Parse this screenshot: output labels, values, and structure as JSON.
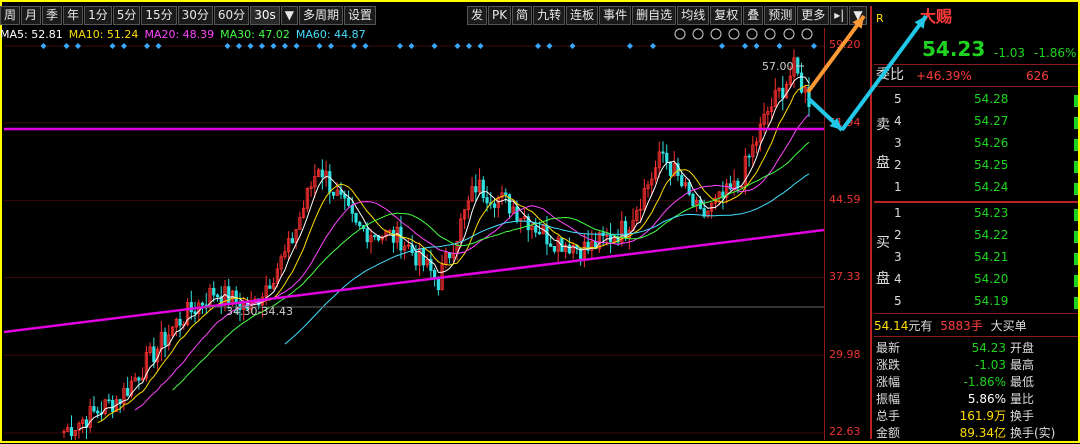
{
  "toolbar": {
    "periods": [
      "周",
      "月",
      "季",
      "年",
      "1分",
      "5分",
      "15分",
      "30分",
      "60分",
      "30s",
      "多周期",
      "设置"
    ],
    "dropdown_glyph": "▼",
    "right_items": [
      "发",
      "PK",
      "简",
      "九转",
      "连板",
      "事件",
      "删自选",
      "均线",
      "复权",
      "叠",
      "预测",
      "更多"
    ]
  },
  "ma_legend": [
    {
      "label": "MA5: 52.81",
      "color": "#ffffff"
    },
    {
      "label": "MA10: 51.24",
      "color": "#ffde00"
    },
    {
      "label": "MA20: 48.39",
      "color": "#ff44ff"
    },
    {
      "label": "MA30: 47.02",
      "color": "#44ff44"
    },
    {
      "label": "MA60: 44.87",
      "color": "#44ddff"
    }
  ],
  "price_axis": [
    "59.20",
    "51.94",
    "44.59",
    "37.33",
    "29.98",
    "22.63"
  ],
  "annotations": {
    "high_label": "57.00",
    "range_label": "34.30-34.43"
  },
  "panel": {
    "r_mark": "R",
    "stock_name": "大赐",
    "price": "54.23",
    "change": "-1.03",
    "change_pct": "-1.86%",
    "weibi_label": "委比",
    "weibi_value": "+46.39%",
    "weicha_value": "626",
    "sell_label": [
      "卖",
      "盘"
    ],
    "buy_label": [
      "买",
      "盘"
    ],
    "sell": [
      {
        "level": "5",
        "price": "54.28"
      },
      {
        "level": "4",
        "price": "54.27"
      },
      {
        "level": "3",
        "price": "54.26"
      },
      {
        "level": "2",
        "price": "54.25"
      },
      {
        "level": "1",
        "price": "54.24"
      }
    ],
    "buy": [
      {
        "level": "1",
        "price": "54.23"
      },
      {
        "level": "2",
        "price": "54.22"
      },
      {
        "level": "3",
        "price": "54.21"
      },
      {
        "level": "4",
        "price": "54.20"
      },
      {
        "level": "5",
        "price": "54.19"
      }
    ],
    "bigbuy": {
      "price": "54.14",
      "unit1": "元有",
      "qty": "5883手",
      "text": "大买单"
    },
    "stats": [
      {
        "l": "最新",
        "v": "54.23",
        "r": "开盘",
        "c": "green"
      },
      {
        "l": "涨跌",
        "v": "-1.03",
        "r": "最高",
        "c": "green"
      },
      {
        "l": "涨幅",
        "v": "-1.86%",
        "r": "最低",
        "c": "green"
      },
      {
        "l": "振幅",
        "v": "5.86%",
        "r": "量比",
        "c": "white"
      },
      {
        "l": "总手",
        "v": "161.9万",
        "r": "换手",
        "c": "yellow"
      },
      {
        "l": "金额",
        "v": "89.34亿",
        "r": "换手(实)",
        "c": "yellow"
      }
    ]
  }
}
